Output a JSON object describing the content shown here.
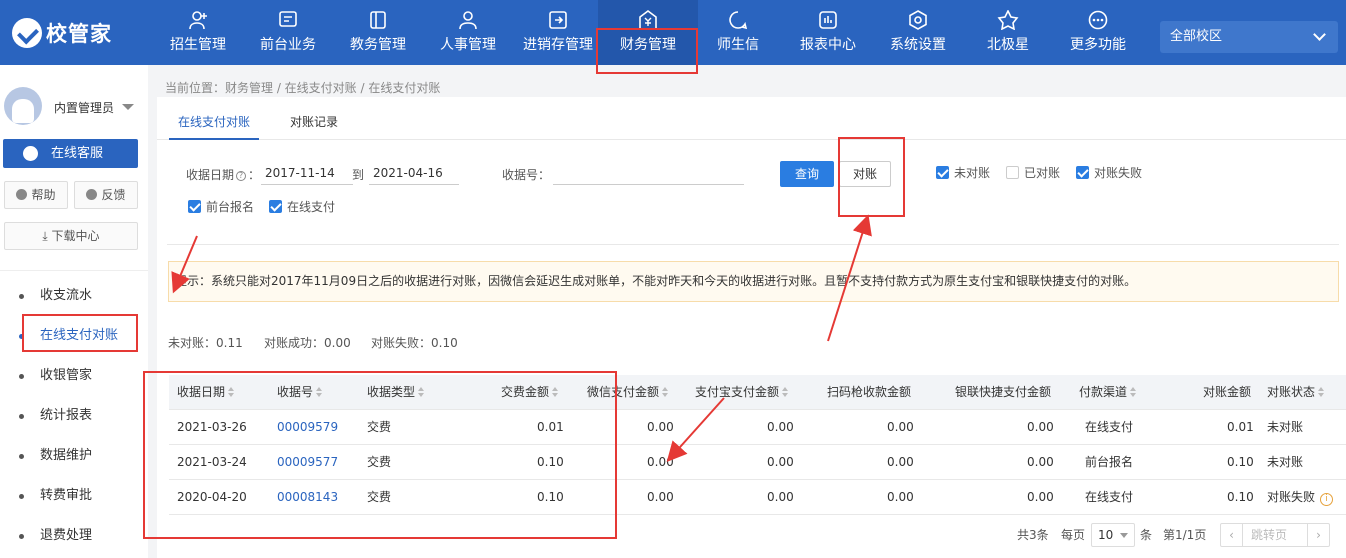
{
  "app": {
    "logo": "校管家",
    "campus": "全部校区"
  },
  "nav": [
    {
      "label": "招生管理",
      "icon": "user-plus-icon"
    },
    {
      "label": "前台业务",
      "icon": "desk-icon"
    },
    {
      "label": "教务管理",
      "icon": "book-icon"
    },
    {
      "label": "人事管理",
      "icon": "person-icon"
    },
    {
      "label": "进销存管理",
      "icon": "inventory-icon"
    },
    {
      "label": "财务管理",
      "icon": "finance-icon"
    },
    {
      "label": "师生信",
      "icon": "message-icon"
    },
    {
      "label": "报表中心",
      "icon": "chart-icon"
    },
    {
      "label": "系统设置",
      "icon": "settings-icon"
    },
    {
      "label": "北极星",
      "icon": "star-icon"
    },
    {
      "label": "更多功能",
      "icon": "more-icon"
    }
  ],
  "sidebar": {
    "user": "内置管理员",
    "service_button": "在线客服",
    "help": "帮助",
    "feedback": "反馈",
    "download": "下载中心",
    "items": [
      "收支流水",
      "在线支付对账",
      "收银管家",
      "统计报表",
      "数据维护",
      "转费审批",
      "退费处理"
    ]
  },
  "breadcrumb": "当前位置：财务管理 / 在线支付对账 / 在线支付对账",
  "tabs": [
    "在线支付对账",
    "对账记录"
  ],
  "filters": {
    "date_label": "收据日期",
    "help_mark": "?",
    "date_from": "2017-11-14",
    "to_label": "到",
    "date_to": "2021-04-16",
    "receipt_label": "收据号：",
    "receipt_value": "",
    "query_button": "查询",
    "reconcile_button": "对账",
    "checkboxes": [
      {
        "label": "未对账",
        "checked": true
      },
      {
        "label": "已对账",
        "checked": false
      },
      {
        "label": "对账失败",
        "checked": true
      },
      {
        "label": "前台报名",
        "checked": true
      },
      {
        "label": "在线支付",
        "checked": true
      }
    ]
  },
  "tip": "提示：系统只能对2017年11月09日之后的收据进行对账，因微信会延迟生成对账单，不能对昨天和今天的收据进行对账。且暂不支持付款方式为原生支付宝和银联快捷支付的对账。",
  "summary": {
    "unreconciled": "未对账：0.11",
    "success": "对账成功：0.00",
    "failed": "对账失败：0.10"
  },
  "table": {
    "headers": [
      "收据日期",
      "收据号",
      "收据类型",
      "交费金额",
      "微信支付金额",
      "支付宝支付金额",
      "扫码枪收款金额",
      "银联快捷支付金额",
      "付款渠道",
      "对账金额",
      "对账状态"
    ],
    "rows": [
      [
        "2021-03-26",
        "00009579",
        "交费",
        "0.01",
        "0.00",
        "0.00",
        "0.00",
        "0.00",
        "在线支付",
        "0.01",
        "未对账"
      ],
      [
        "2021-03-24",
        "00009577",
        "交费",
        "0.10",
        "0.00",
        "0.00",
        "0.00",
        "0.00",
        "前台报名",
        "0.10",
        "未对账"
      ],
      [
        "2020-04-20",
        "00008143",
        "交费",
        "0.10",
        "0.00",
        "0.00",
        "0.00",
        "0.00",
        "在线支付",
        "0.10",
        "对账失败"
      ]
    ]
  },
  "pagination": {
    "total": "共3条",
    "per_page_label": "每页",
    "per_page": "10",
    "unit": "条",
    "page": "第1/1页",
    "jump": "跳转页"
  },
  "colors": {
    "primary": "#2a64bf",
    "annotation": "#e53935"
  }
}
